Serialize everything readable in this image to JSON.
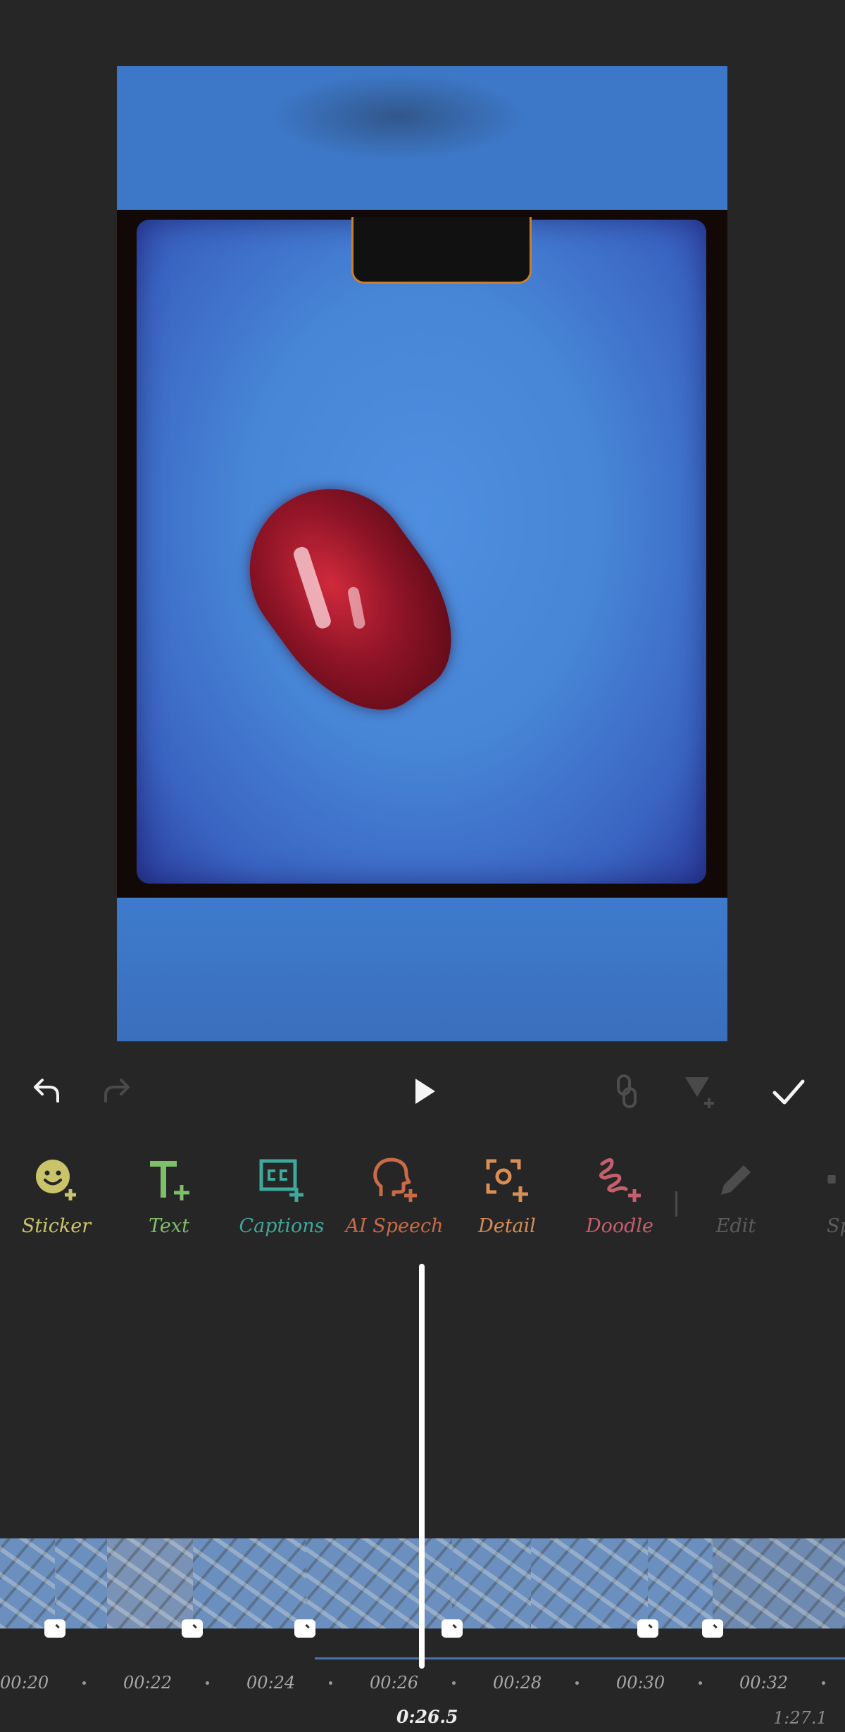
{
  "controls": {
    "undo_icon": "undo-arrow",
    "redo_icon": "redo-arrow",
    "play_icon": "play-triangle",
    "link_icon": "chain-link",
    "keyframe_icon": "keyframe-add",
    "confirm_icon": "checkmark"
  },
  "tools": [
    {
      "label": "Sticker",
      "icon": "sticker-add",
      "color": "#c9c46a"
    },
    {
      "label": "Text",
      "icon": "text-add",
      "color": "#7fbf6a"
    },
    {
      "label": "Captions",
      "icon": "captions-add",
      "color": "#3ea89a"
    },
    {
      "label": "AI Speech",
      "icon": "ai-speech-add",
      "color": "#c96a48"
    },
    {
      "label": "Detail",
      "icon": "detail-add",
      "color": "#d98e56"
    },
    {
      "label": "Doodle",
      "icon": "doodle-add",
      "color": "#c4606e"
    },
    {
      "label": "Edit",
      "icon": "pencil",
      "color": "#5c5c5c"
    },
    {
      "label": "Sp",
      "icon": "split",
      "color": "#5c5c5c"
    }
  ],
  "timeline": {
    "ticks": [
      "00:20",
      "00:22",
      "00:24",
      "00:26",
      "00:28",
      "00:30",
      "00:32"
    ],
    "current_time": "0:26.5",
    "total_time": "1:27.1"
  }
}
